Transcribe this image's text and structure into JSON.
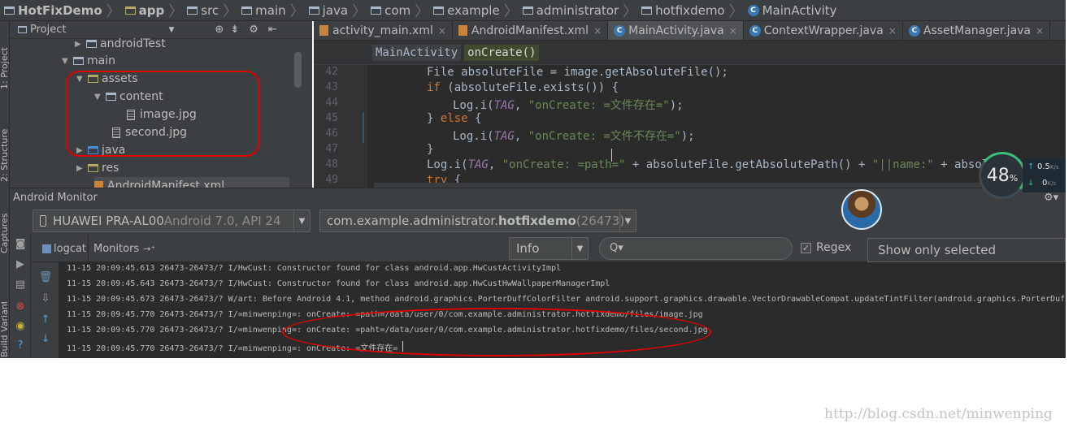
{
  "breadcrumb": [
    "HotFixDemo",
    "app",
    "src",
    "main",
    "java",
    "com",
    "example",
    "administrator",
    "hotfixdemo",
    "MainActivity"
  ],
  "stripe": {
    "project": "1: Project",
    "structure": "2: Structure",
    "captures": "Captures",
    "variants": "Build Variants"
  },
  "project_panel": {
    "title": "Project",
    "tree": [
      "androidTest",
      "main",
      "assets",
      "content",
      "image.jpg",
      "second.jpg",
      "java",
      "res",
      "AndroidManifest.xml"
    ]
  },
  "editor": {
    "tabs": [
      "activity_main.xml",
      "AndroidManifest.xml",
      "MainActivity.java",
      "ContextWrapper.java",
      "AssetManager.java"
    ],
    "active_tab": "MainActivity.java",
    "crumbs": [
      "MainActivity",
      "onCreate()"
    ],
    "line_numbers": [
      "42",
      "43",
      "44",
      "45",
      "46",
      "47",
      "48",
      "49"
    ],
    "code": {
      "l42": "File absoluteFile = image.getAbsoluteFile();",
      "l43_kw": "if",
      "l43_rest": " (absoluteFile.exists()) {",
      "l44_a": "Log.i(",
      "l44_const": "TAG",
      "l44_b": ", ",
      "l44_str": "\"onCreate: =文件存在=\"",
      "l44_c": ");",
      "l45_a": "} ",
      "l45_kw": "else",
      "l45_b": " {",
      "l46_a": "Log.i(",
      "l46_const": "TAG",
      "l46_b": ", ",
      "l46_str": "\"onCreate: =文件不存在=\"",
      "l46_c": ");",
      "l47": "}",
      "l48_a": "Log.i(",
      "l48_const": "TAG",
      "l48_b": ", ",
      "l48_str1": "\"onCreate: =path=\"",
      "l48_c": " + absoluteFile.getAbsolutePath() + ",
      "l48_str2": "\"||name:\"",
      "l48_d": " + absoluteFi",
      "l49_kw": "try",
      "l49_rest": " {"
    }
  },
  "monitor": {
    "title": "Android Monitor",
    "device_name": "HUAWEI PRA-AL00",
    "device_info": " Android 7.0, API 24",
    "process_prefix": "com.example.administrator.",
    "process_app": "hotfixdemo",
    "process_pid": " (26473)",
    "tab_logcat": "logcat",
    "tab_monitors": "Monitors",
    "log_level": "Info",
    "search_placeholder": "Q▾",
    "regex_label": "Regex",
    "regex_checked": true,
    "filter": "Show only selected application"
  },
  "log_lines": [
    "11-15 20:09:45.613 26473-26473/? I/HwCust: Constructor found for class android.app.HwCustActivityImpl",
    "11-15 20:09:45.643 26473-26473/? I/HwCust: Constructor found for class android.app.HwCustHwWallpaperManagerImpl",
    "11-15 20:09:45.673 26473-26473/? W/art: Before Android 4.1, method android.graphics.PorterDuffColorFilter android.support.graphics.drawable.VectorDrawableCompat.updateTintFilter(android.graphics.PorterDuff",
    "11-15 20:09:45.770 26473-26473/? I/=minwenping=: onCreate: =path=/data/user/0/com.example.administrator.hotfixdemo/files/image.jpg",
    "11-15 20:09:45.770 26473-26473/? I/=minwenping=: onCreate: =paht=/data/user/0/com.example.administrator.hotfixdemo/files/second.jpg",
    "11-15 20:09:45.770 26473-26473/? I/=minwenping=: onCreate: =文件存在="
  ],
  "overlay": {
    "memory_percent": "48",
    "memory_unit": "%",
    "net_up": "0.5",
    "net_down": "0",
    "net_unit": "K/s",
    "gauge_color": "#3dbb7a",
    "annotation_color": "#e00000"
  },
  "watermark": "http://blog.csdn.net/minwenping"
}
